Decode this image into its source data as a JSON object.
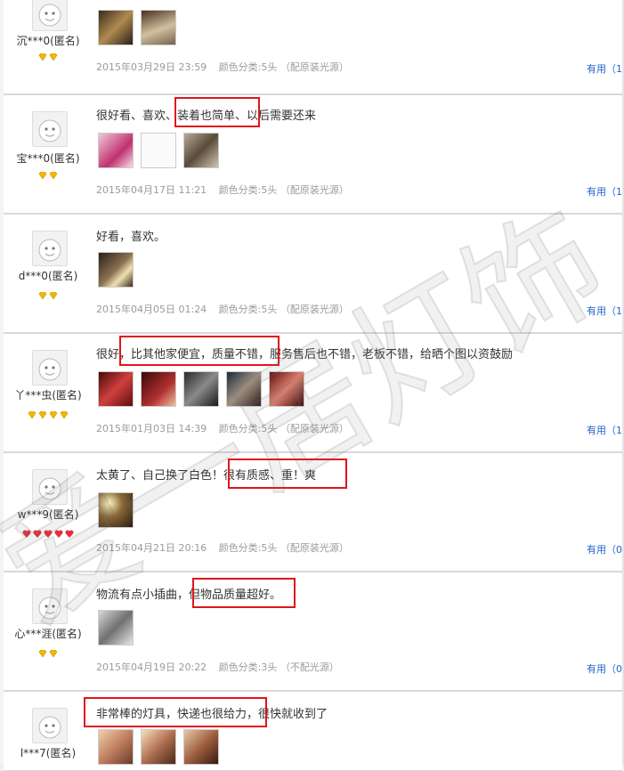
{
  "reviews": [
    {
      "user": "沉***0(匿名)",
      "rank": "diamond-2",
      "comment": "",
      "date": "2015年03月29日 23:59",
      "sku": "颜色分类:5头 （配原装光源）",
      "useful": "有用（1"
    },
    {
      "user": "宝***0(匿名)",
      "rank": "diamond-2",
      "comment": "很好看、喜欢、装着也简单、以后需要还来",
      "date": "2015年04月17日 11:21",
      "sku": "颜色分类:5头 （配原装光源）",
      "useful": "有用（1"
    },
    {
      "user": "d***0(匿名)",
      "rank": "diamond-2",
      "comment": "好看，喜欢。",
      "date": "2015年04月05日 01:24",
      "sku": "颜色分类:5头 （配原装光源）",
      "useful": "有用（1"
    },
    {
      "user": "丫***虫(匿名)",
      "rank": "diamond-4",
      "comment": "很好，比其他家便宜，质量不错，服务售后也不错，老板不错，给晒个图以资鼓励",
      "date": "2015年01月03日 14:39",
      "sku": "颜色分类:5头 （配原装光源）",
      "useful": "有用（1"
    },
    {
      "user": "w***9(匿名)",
      "rank": "heart-5",
      "comment": "太黄了、自己换了白色！很有质感、重！爽",
      "date": "2015年04月21日 20:16",
      "sku": "颜色分类:5头 （配原装光源）",
      "useful": "有用（0"
    },
    {
      "user": "心***涯(匿名)",
      "rank": "diamond-2",
      "comment": "物流有点小插曲，但物品质量超好。",
      "date": "2015年04月19日 20:22",
      "sku": "颜色分类:3头 （不配光源）",
      "useful": "有用（0"
    },
    {
      "user": "l***7(匿名)",
      "rank": "",
      "comment": "非常棒的灯具，快递也很给力，很快就收到了",
      "date": "",
      "sku": "",
      "useful": ""
    }
  ],
  "watermark": "爱一居灯饰",
  "colors": {
    "highlight": "#e0151d",
    "link": "#2266cc",
    "meta": "#9a9a9a",
    "diamond": "#f5b800",
    "heart": "#e03040"
  }
}
